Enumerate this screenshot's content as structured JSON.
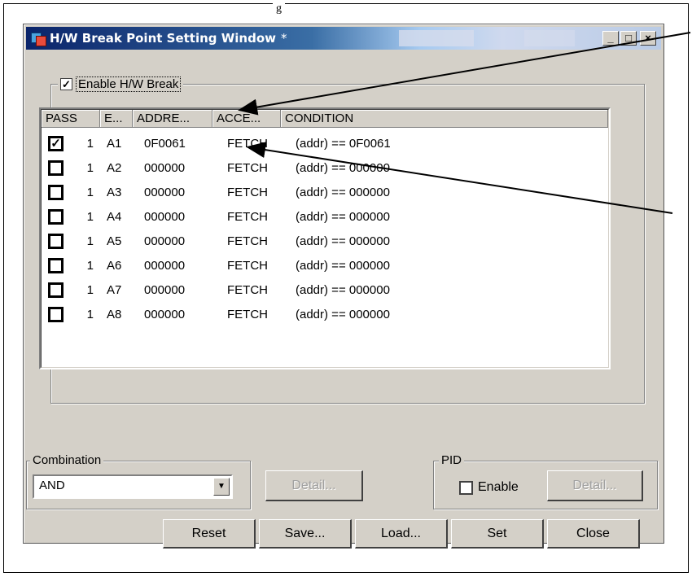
{
  "window": {
    "title": "H/W Break Point Setting Window",
    "title_suffix": "*",
    "minimize": "_",
    "maximize": "□",
    "close": "×"
  },
  "enable_group": {
    "label": "Enable H/W Break",
    "checked": true
  },
  "table": {
    "headers": [
      "PASS",
      "E...",
      "ADDRE...",
      "ACCE...",
      "CONDITION"
    ],
    "rows": [
      {
        "checked": true,
        "pass": "1",
        "e": "A1",
        "address": "0F0061",
        "access": "FETCH",
        "condition": "(addr) == 0F0061"
      },
      {
        "checked": false,
        "pass": "1",
        "e": "A2",
        "address": "000000",
        "access": "FETCH",
        "condition": "(addr) == 000000"
      },
      {
        "checked": false,
        "pass": "1",
        "e": "A3",
        "address": "000000",
        "access": "FETCH",
        "condition": "(addr) == 000000"
      },
      {
        "checked": false,
        "pass": "1",
        "e": "A4",
        "address": "000000",
        "access": "FETCH",
        "condition": "(addr) == 000000"
      },
      {
        "checked": false,
        "pass": "1",
        "e": "A5",
        "address": "000000",
        "access": "FETCH",
        "condition": "(addr) == 000000"
      },
      {
        "checked": false,
        "pass": "1",
        "e": "A6",
        "address": "000000",
        "access": "FETCH",
        "condition": "(addr) == 000000"
      },
      {
        "checked": false,
        "pass": "1",
        "e": "A7",
        "address": "000000",
        "access": "FETCH",
        "condition": "(addr) == 000000"
      },
      {
        "checked": false,
        "pass": "1",
        "e": "A8",
        "address": "000000",
        "access": "FETCH",
        "condition": "(addr) == 000000"
      }
    ]
  },
  "combination": {
    "label": "Combination",
    "value": "AND",
    "detail_label": "Detail..."
  },
  "pid": {
    "label": "PID",
    "enable_label": "Enable",
    "enable_checked": false,
    "detail_label": "Detail..."
  },
  "buttons": {
    "reset": "Reset",
    "save": "Save...",
    "load": "Load...",
    "set": "Set",
    "close": "Close"
  },
  "page": {
    "caption_fragment": "g"
  }
}
